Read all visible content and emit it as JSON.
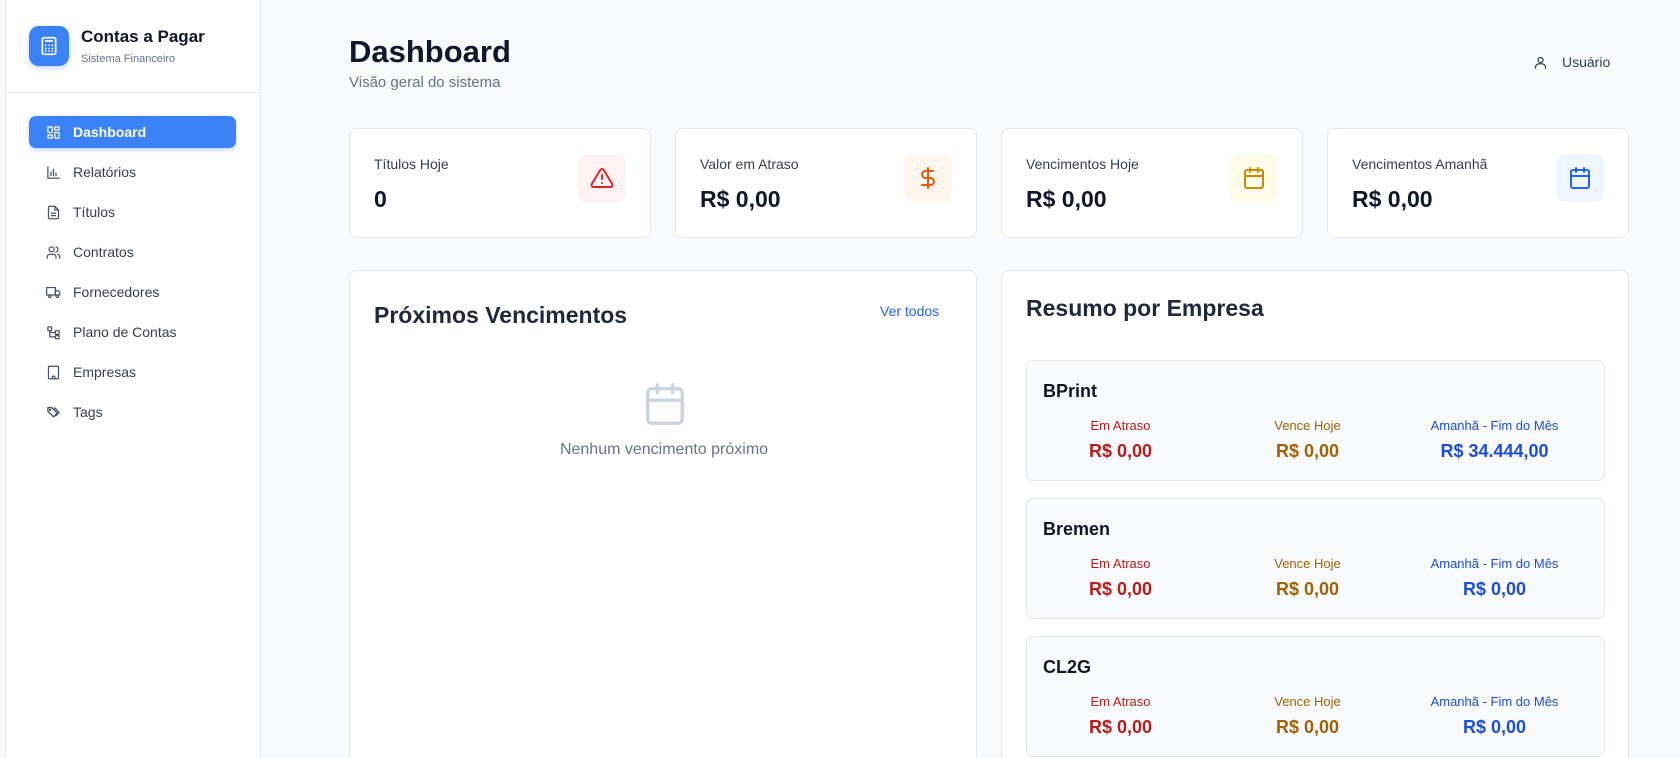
{
  "brand": {
    "title": "Contas a Pagar",
    "subtitle": "Sistema Financeiro"
  },
  "nav": [
    {
      "label": "Dashboard",
      "icon": "dashboard-icon",
      "active": true
    },
    {
      "label": "Relatórios",
      "icon": "bar-chart-icon"
    },
    {
      "label": "Títulos",
      "icon": "document-icon"
    },
    {
      "label": "Contratos",
      "icon": "users-icon"
    },
    {
      "label": "Fornecedores",
      "icon": "truck-icon"
    },
    {
      "label": "Plano de Contas",
      "icon": "hierarchy-icon"
    },
    {
      "label": "Empresas",
      "icon": "building-icon"
    },
    {
      "label": "Tags",
      "icon": "tags-icon"
    }
  ],
  "header": {
    "title": "Dashboard",
    "subtitle": "Visão geral do sistema",
    "user": "Usuário"
  },
  "stats": [
    {
      "label": "Títulos Hoje",
      "value": "0",
      "icon": "alert-triangle-icon",
      "color": "#dc2626",
      "bg": "#fef2f2"
    },
    {
      "label": "Valor em Atraso",
      "value": "R$ 0,00",
      "icon": "dollar-icon",
      "color": "#ea580c",
      "bg": "#fff7ed"
    },
    {
      "label": "Vencimentos Hoje",
      "value": "R$ 0,00",
      "icon": "calendar-icon",
      "color": "#ca8a04",
      "bg": "#fefce8"
    },
    {
      "label": "Vencimentos Amanhã",
      "value": "R$ 0,00",
      "icon": "calendar-icon",
      "color": "#2563eb",
      "bg": "#eff6ff"
    }
  ],
  "proximos": {
    "title": "Próximos Vencimentos",
    "link": "Ver todos",
    "empty": "Nenhum vencimento próximo"
  },
  "resumo": {
    "title": "Resumo por Empresa",
    "labels": {
      "atraso": "Em Atraso",
      "hoje": "Vence Hoje",
      "amanha": "Amanhã - Fim do Mês"
    },
    "empresas": [
      {
        "name": "BPrint",
        "atraso": "R$ 0,00",
        "hoje": "R$ 0,00",
        "amanha": "R$ 34.444,00"
      },
      {
        "name": "Bremen",
        "atraso": "R$ 0,00",
        "hoje": "R$ 0,00",
        "amanha": "R$ 0,00"
      },
      {
        "name": "CL2G",
        "atraso": "R$ 0,00",
        "hoje": "R$ 0,00",
        "amanha": "R$ 0,00"
      }
    ]
  }
}
